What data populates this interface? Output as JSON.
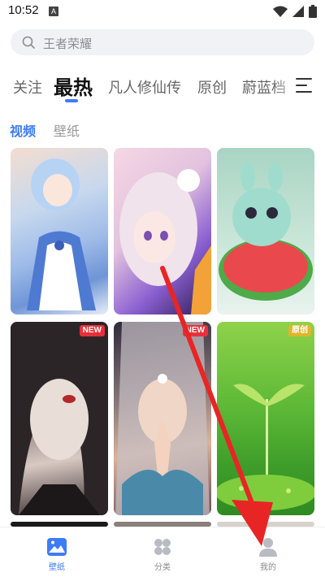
{
  "status_bar": {
    "time": "10:52",
    "notification_letter": "A"
  },
  "search": {
    "placeholder_text": "王者荣耀",
    "icon": "search-icon"
  },
  "tabs": [
    {
      "label": "关注",
      "active": false
    },
    {
      "label": "最热",
      "active": true
    },
    {
      "label": "凡人修仙传",
      "active": false
    },
    {
      "label": "原创",
      "active": false
    },
    {
      "label": "蔚蓝档",
      "active": false
    }
  ],
  "subtabs": [
    {
      "label": "视频",
      "active": true
    },
    {
      "label": "壁纸",
      "active": false
    }
  ],
  "grid": {
    "items": [
      {
        "badge": ""
      },
      {
        "badge": ""
      },
      {
        "badge": ""
      },
      {
        "badge": "NEW"
      },
      {
        "badge": "NEW"
      },
      {
        "badge": "原创"
      }
    ]
  },
  "bottom_nav": [
    {
      "label": "壁纸",
      "icon": "wallpaper-icon",
      "active": true
    },
    {
      "label": "分类",
      "icon": "category-icon",
      "active": false
    },
    {
      "label": "我的",
      "icon": "profile-icon",
      "active": false
    }
  ],
  "colors": {
    "accent": "#3d7bf7",
    "badge_new": "#e8303b",
    "badge_original": "#e0b62a",
    "annotation_arrow": "#e82525"
  }
}
